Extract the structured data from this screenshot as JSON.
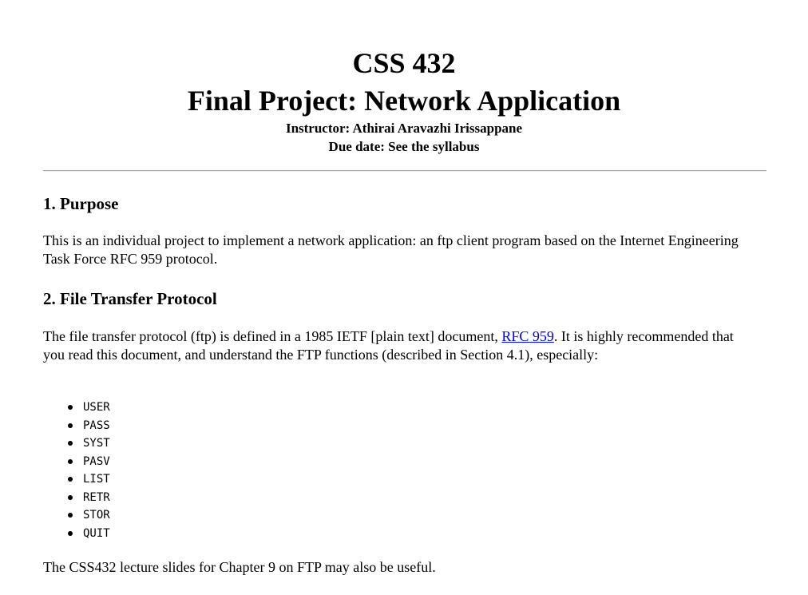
{
  "header": {
    "course": "CSS 432",
    "title": "Final Project: Network Application",
    "instructor": "Instructor: Athirai Aravazhi Irissappane",
    "due": "Due date: See the syllabus"
  },
  "purpose": {
    "heading": "1. Purpose",
    "text": "This is an individual project to implement a network application: an ftp client program based on the Internet Engineering Task Force RFC 959 protocol."
  },
  "ftp": {
    "heading": "2. File Transfer Protocol",
    "intro_before_link": "The file transfer protocol (ftp) is defined in a 1985 IETF [plain text] document, ",
    "link_text": "RFC 959",
    "intro_after_link": ". It is highly recommended that you read this document, and understand the FTP functions (described in Section 4.1), especially:",
    "commands": [
      "USER",
      "PASS",
      "SYST",
      "PASV",
      "LIST",
      "RETR",
      "STOR",
      "QUIT"
    ],
    "closing": "The CSS432 lecture slides for Chapter 9 on FTP may also be useful."
  },
  "colors": {
    "link": "#0000ee",
    "rule": "#a9a9a9",
    "text": "#000000"
  }
}
